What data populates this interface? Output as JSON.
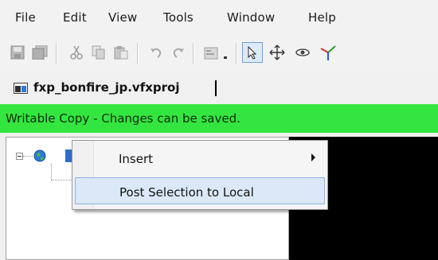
{
  "menubar": {
    "items": [
      {
        "label": "File"
      },
      {
        "label": "Edit"
      },
      {
        "label": "View"
      },
      {
        "label": "Tools"
      },
      {
        "label": "Window"
      },
      {
        "label": "Help"
      }
    ]
  },
  "toolbar": {
    "buttons": [
      {
        "icon": "save-icon"
      },
      {
        "icon": "save-all-icon"
      },
      {
        "icon": "cut-icon"
      },
      {
        "icon": "copy-icon"
      },
      {
        "icon": "paste-icon"
      },
      {
        "icon": "undo-icon"
      },
      {
        "icon": "redo-icon"
      },
      {
        "icon": "properties-icon"
      },
      {
        "icon": "select-arrow-icon",
        "active": true
      },
      {
        "icon": "move-icon"
      },
      {
        "icon": "orbit-icon"
      },
      {
        "icon": "axis-icon"
      }
    ]
  },
  "project": {
    "file_name": "fxp_bonfire_jp.vfxproj"
  },
  "status": {
    "text": "Writable Copy - Changes can be saved.",
    "color": "#35e53f"
  },
  "context_menu": {
    "items": [
      {
        "label": "Insert",
        "has_submenu": true
      },
      {
        "label": "Post Selection to Local",
        "highlighted": true
      }
    ]
  },
  "colors": {
    "status_green": "#35e53f",
    "selection_blue": "#2f6ec8",
    "menu_highlight": "#dbe8f8",
    "viewport": "#000000"
  }
}
